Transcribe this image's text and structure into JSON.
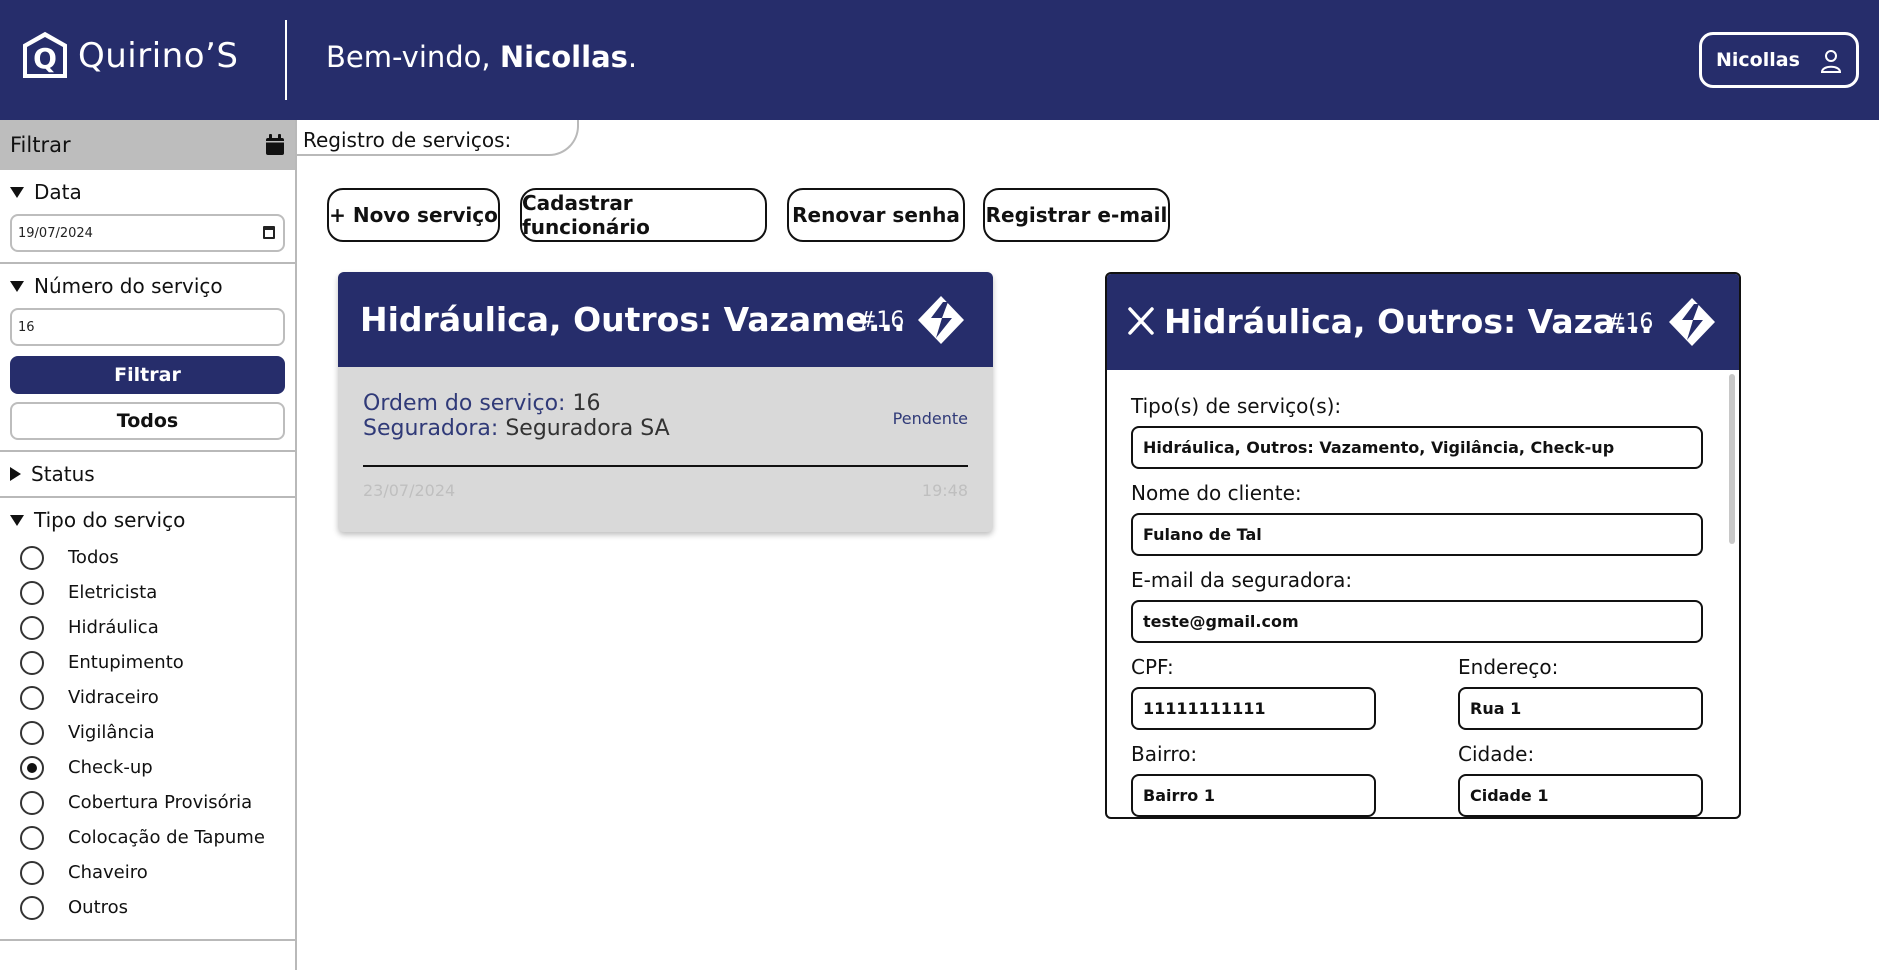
{
  "header": {
    "brand_letter": "Q",
    "brand_name": "Quirino’S",
    "welcome_prefix": "Bem-vindo, ",
    "welcome_name": "Nicollas",
    "welcome_suffix": ".",
    "user_button": "Nicollas"
  },
  "sidebar": {
    "filter_title": "Filtrar",
    "date_section": "Data",
    "date_value": "19/07/2024",
    "number_section": "Número do serviço",
    "number_value": "16",
    "filter_button": "Filtrar",
    "all_button": "Todos",
    "status_section": "Status",
    "type_section": "Tipo do serviço",
    "types": [
      {
        "label": "Todos",
        "checked": false
      },
      {
        "label": "Eletricista",
        "checked": false
      },
      {
        "label": "Hidráulica",
        "checked": false
      },
      {
        "label": "Entupimento",
        "checked": false
      },
      {
        "label": "Vidraceiro",
        "checked": false
      },
      {
        "label": "Vigilância",
        "checked": false
      },
      {
        "label": "Check-up",
        "checked": true
      },
      {
        "label": "Cobertura Provisória",
        "checked": false
      },
      {
        "label": "Colocação de Tapume",
        "checked": false
      },
      {
        "label": "Chaveiro",
        "checked": false
      },
      {
        "label": "Outros",
        "checked": false
      }
    ]
  },
  "main": {
    "registry_label": "Registro de serviços:",
    "actions": {
      "new_service": "+ Novo serviço",
      "register_employee": "Cadastrar funcionário",
      "renew_password": "Renovar senha",
      "register_email": "Registrar e-mail"
    },
    "card": {
      "title": "Hidráulica, Outros: Vazame...",
      "number": "#16",
      "order_label": "Ordem do serviço:",
      "order_value": "16",
      "insurer_label": "Seguradora:",
      "insurer_value": "Seguradora SA",
      "status": "Pendente",
      "date": "23/07/2024",
      "time": "19:48"
    },
    "detail": {
      "title": "Hidráulica, Outros: Vaza...",
      "number": "#16",
      "service_types_label": "Tipo(s) de serviço(s):",
      "service_types_value": "Hidráulica, Outros: Vazamento, Vigilância, Check-up",
      "client_label": "Nome do cliente:",
      "client_value": "Fulano de Tal",
      "email_label": "E-mail da seguradora:",
      "email_value": "teste@gmail.com",
      "cpf_label": "CPF:",
      "cpf_value": "11111111111",
      "address_label": "Endereço:",
      "address_value": "Rua 1",
      "district_label": "Bairro:",
      "district_value": "Bairro 1",
      "city_label": "Cidade:",
      "city_value": "Cidade 1"
    }
  },
  "colors": {
    "brand": "#262d6b",
    "card_bg": "#d9d9d9",
    "muted": "#bfbfbf"
  }
}
